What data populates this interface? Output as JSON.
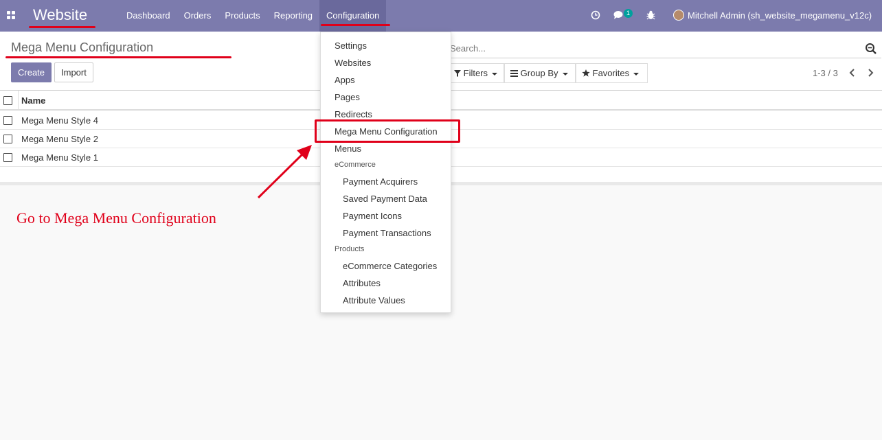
{
  "navbar": {
    "app_title": "Website",
    "menu": [
      {
        "label": "Dashboard"
      },
      {
        "label": "Orders"
      },
      {
        "label": "Products"
      },
      {
        "label": "Reporting"
      },
      {
        "label": "Configuration"
      }
    ],
    "messages_count": "1",
    "user": "Mitchell Admin (sh_website_megamenu_v12c)",
    "icons": [
      "apps-icon",
      "clock-icon",
      "chat-icon",
      "bug-icon",
      "avatar"
    ]
  },
  "control_panel": {
    "breadcrumb": "Mega Menu Configuration",
    "create_label": "Create",
    "import_label": "Import",
    "search_placeholder": "Search...",
    "filters_label": "Filters",
    "groupby_label": "Group By",
    "favorites_label": "Favorites",
    "pager": "1-3 / 3"
  },
  "list": {
    "column": "Name",
    "rows": [
      {
        "name": "Mega Menu Style 4"
      },
      {
        "name": "Mega Menu Style 2"
      },
      {
        "name": "Mega Menu Style 1"
      }
    ]
  },
  "dropdown": {
    "items": [
      "Settings",
      "Websites",
      "Apps",
      "Pages",
      "Redirects",
      "Mega Menu Configuration",
      "Menus"
    ],
    "ecommerce_header": "eCommerce",
    "ecommerce_items": [
      "Payment Acquirers",
      "Saved Payment Data",
      "Payment Icons",
      "Payment Transactions"
    ],
    "products_header": "Products",
    "products_items": [
      "eCommerce Categories",
      "Attributes",
      "Attribute Values"
    ]
  },
  "annotation": {
    "text": "Go to Mega Menu Configuration",
    "color": "#e0001a"
  },
  "colors": {
    "brand": "#7c7bad",
    "badge": "#00a09d"
  }
}
